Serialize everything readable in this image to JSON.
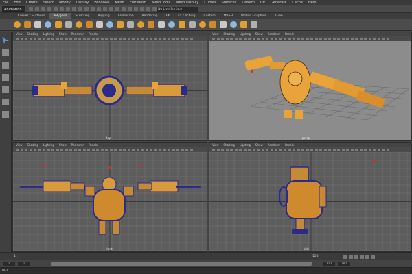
{
  "menubar": {
    "items": [
      "File",
      "Edit",
      "Create",
      "Select",
      "Modify",
      "Display",
      "Windows",
      "Mesh",
      "Edit Mesh",
      "Mesh Tools",
      "Mesh Display",
      "Curves",
      "Surfaces",
      "Deform",
      "UV",
      "Generate",
      "Cache",
      "Help"
    ]
  },
  "statusline": {
    "mode": "Animation",
    "field": "No Live Surface"
  },
  "shelf": {
    "tabs": [
      {
        "label": "Curves / Surfaces",
        "active": false
      },
      {
        "label": "Polygons",
        "active": true
      },
      {
        "label": "Sculpting",
        "active": false
      },
      {
        "label": "Rigging",
        "active": false
      },
      {
        "label": "Animation",
        "active": false
      },
      {
        "label": "Rendering",
        "active": false
      },
      {
        "label": "FX",
        "active": false
      },
      {
        "label": "FX Caching",
        "active": false
      },
      {
        "label": "Custom",
        "active": false
      },
      {
        "label": "MASH",
        "active": false
      },
      {
        "label": "Motion Graphics",
        "active": false
      },
      {
        "label": "XGen",
        "active": false
      }
    ],
    "icon_names": [
      "sphere-icon",
      "cube-icon",
      "cylinder-icon",
      "cone-icon",
      "plane-icon",
      "torus-icon",
      "disc-icon",
      "platonic-icon",
      "combine-icon",
      "separate-icon",
      "extract-icon",
      "smooth-icon",
      "boolean-icon",
      "mirror-icon",
      "bridge-icon",
      "extrude-icon",
      "bevel-icon",
      "append-icon",
      "fill-hole-icon",
      "multicut-icon",
      "target-weld-icon",
      "uv-icon",
      "sew-icon",
      "unfold-icon"
    ]
  },
  "toolbox": {
    "tools": [
      "select-tool-icon",
      "lasso-tool-icon",
      "paint-select-icon",
      "move-tool-icon",
      "rotate-tool-icon",
      "scale-tool-icon",
      "last-tool-icon"
    ]
  },
  "panel_menu": [
    "View",
    "Shading",
    "Lighting",
    "Show",
    "Renderer",
    "Panels"
  ],
  "viewports": {
    "top": {
      "camera": "top"
    },
    "persp": {
      "camera": "persp"
    },
    "front": {
      "camera": "front"
    },
    "side": {
      "camera": "side"
    }
  },
  "timeline": {
    "start": "1",
    "end": "120",
    "range_start": "1",
    "range_end": "120",
    "total": "200"
  },
  "cmdline": {
    "label": "MEL"
  },
  "colors": {
    "wire": "#2b2b8c",
    "model": "#e8a33a",
    "grid": "#7a7a7a",
    "viewport_bg": "#5d5d5d",
    "persp_bg": "#8c8c8c"
  }
}
